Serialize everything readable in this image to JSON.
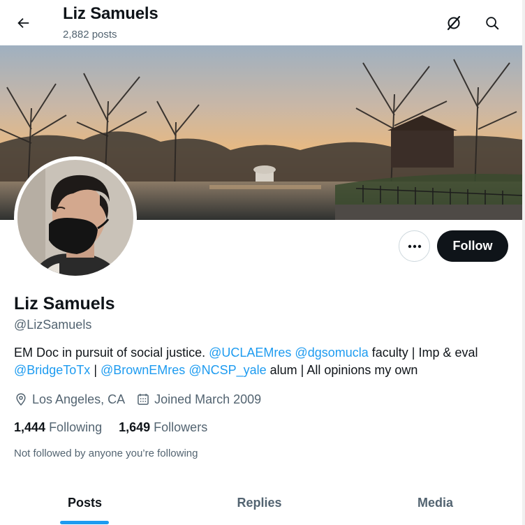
{
  "header": {
    "name": "Liz Samuels",
    "posts_count": "2,882 posts",
    "back_icon": "back-arrow-icon",
    "grok_icon": "grok-icon",
    "search_icon": "search-icon"
  },
  "profile": {
    "name": "Liz Samuels",
    "handle": "@LizSamuels",
    "bio": {
      "text1": "EM Doc in pursuit of social justice. ",
      "mention1": "@UCLAEMres",
      "text2": " ",
      "mention2": "@dgsomucla",
      "text3": " faculty | Imp & eval ",
      "mention3": "@BridgeToTx",
      "text4": " | ",
      "mention4": "@BrownEMres",
      "text5": " ",
      "mention5": "@NCSP_yale",
      "text6": " alum | All opinions my own"
    },
    "location": "Los Angeles, CA",
    "joined": "Joined March 2009",
    "following_count": "1,444",
    "following_label": "Following",
    "followers_count": "1,649",
    "followers_label": "Followers",
    "not_followed_text": "Not followed by anyone you’re following"
  },
  "actions": {
    "more_icon": "more-dots-icon",
    "follow_label": "Follow"
  },
  "tabs": [
    {
      "label": "Posts",
      "active": true
    },
    {
      "label": "Replies",
      "active": false
    },
    {
      "label": "Media",
      "active": false
    }
  ],
  "colors": {
    "accent": "#1d9bf0",
    "text_primary": "#0f1419",
    "text_secondary": "#536471",
    "follow_bg": "#0f1419"
  }
}
